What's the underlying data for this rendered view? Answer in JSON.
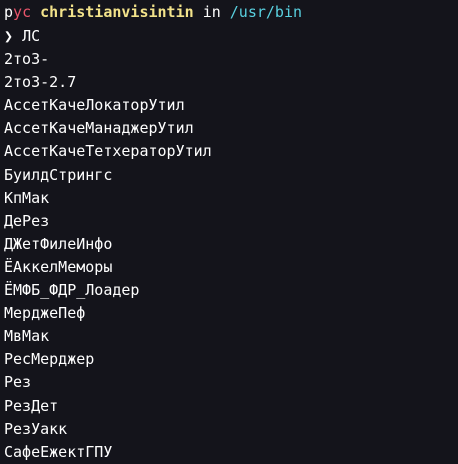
{
  "prompt": {
    "host_p": "р",
    "host_y": "у",
    "host_c": "с",
    "user": "christianvisintin",
    "in_word": "in",
    "path": "/usr/bin"
  },
  "command": {
    "chevron": "❯",
    "text": "ЛС"
  },
  "listing": [
    "2то3-",
    "2то3-2.7",
    "АссетКачеЛокаторУтил",
    "АссетКачеМанаджерУтил",
    "АссетКачеТетхераторУтил",
    "БуилдСтрингс",
    "КпМак",
    "ДеРез",
    "ДЖетФилеИнфо",
    "ЁАккелМеморы",
    "ЁМФБ_ФДР_Лоадер",
    "МерджеПеф",
    "МвМак",
    "РесМерджер",
    "Рез",
    "РезДет",
    "РезУакк",
    "СафеЕжектГПУ"
  ],
  "colors": {
    "background": "#14141b",
    "text": "#ffffff",
    "host_accent": "#e9556b",
    "user": "#f3e38b",
    "path": "#59d1e0"
  }
}
